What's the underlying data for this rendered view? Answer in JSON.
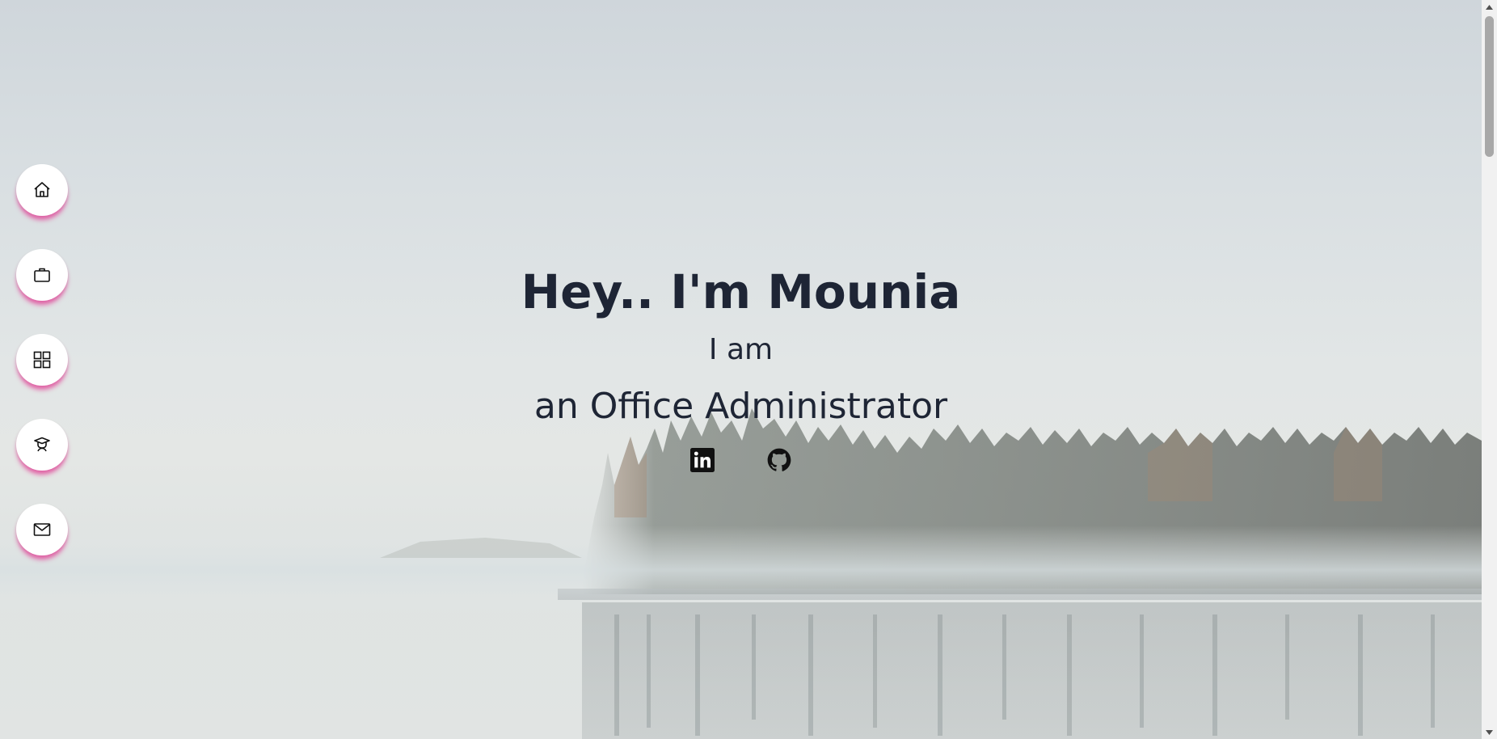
{
  "hero": {
    "title": "Hey.. I'm Mounia",
    "intro": "I am",
    "role": "an Office Administrator"
  },
  "side_nav": {
    "items": [
      {
        "name": "home",
        "icon": "home-icon"
      },
      {
        "name": "experience",
        "icon": "briefcase-icon"
      },
      {
        "name": "projects",
        "icon": "grid-icon"
      },
      {
        "name": "education",
        "icon": "graduate-icon"
      },
      {
        "name": "contact",
        "icon": "mail-icon"
      }
    ]
  },
  "social": {
    "links": [
      {
        "name": "linkedin",
        "icon": "linkedin-icon"
      },
      {
        "name": "github",
        "icon": "github-icon"
      }
    ]
  },
  "colors": {
    "text": "#1e2535",
    "nav_shadow": "#e63c96",
    "nav_bg": "#ffffff"
  }
}
